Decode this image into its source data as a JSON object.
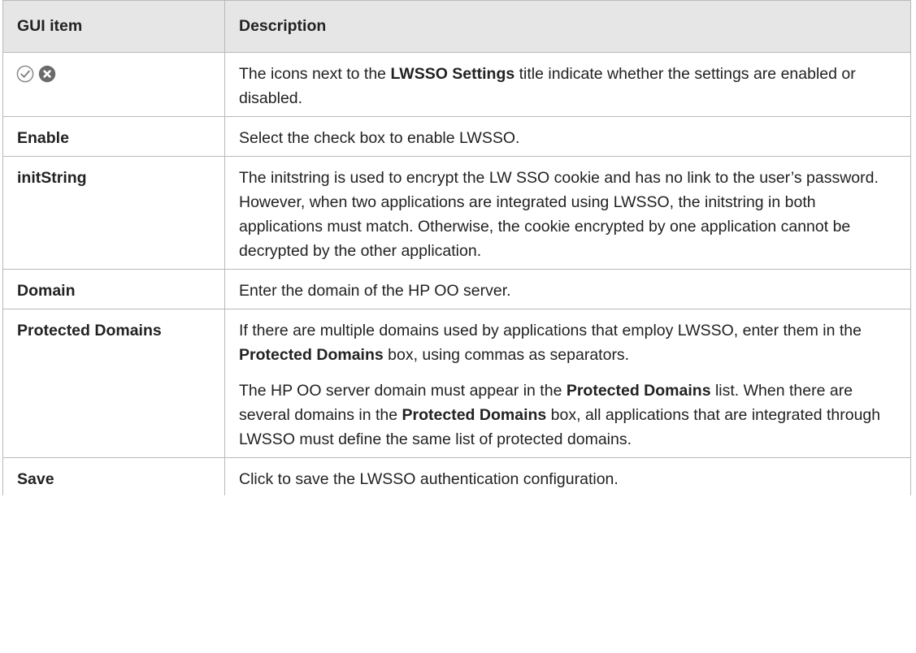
{
  "table": {
    "headers": {
      "item": "GUI item",
      "description": "Description"
    },
    "rows": {
      "icons": {
        "icon_names": [
          "check-circle-icon",
          "x-circle-icon"
        ],
        "desc": {
          "t1": "The icons next to the ",
          "b1": "LWSSO Settings",
          "t2": " title indicate whether the settings are enabled or disabled."
        }
      },
      "enable": {
        "label": "Enable",
        "desc": "Select the check box to enable LWSSO."
      },
      "initstring": {
        "label": "initString",
        "desc": "The initstring is used to encrypt the LW SSO cookie and has no link to the user’s password. However, when two applications are integrated using LWSSO, the initstring in both applications must match. Otherwise, the cookie encrypted by one application cannot be decrypted by the other application."
      },
      "domain": {
        "label": "Domain",
        "desc": "Enter the domain of the HP OO server."
      },
      "protected": {
        "label": "Protected Domains",
        "p1": {
          "t1": "If there are multiple domains used by applications that employ LWSSO, enter them in the ",
          "b1": "Protected Domains",
          "t2": " box, using commas as separators."
        },
        "p2": {
          "t1": "The HP OO server domain must appear in the ",
          "b1": "Protected Domains",
          "t2": " list. When there are several domains in the ",
          "b2": "Protected Domains",
          "t3": " box, all applications that are integrated through LWSSO must define the same list of protected domains."
        }
      },
      "save": {
        "label": "Save",
        "desc": "Click to save the LWSSO authentication configuration."
      }
    }
  },
  "colors": {
    "header_bg": "#e6e6e6",
    "border": "#b9b9b9",
    "text": "#222222",
    "icon_fill": "#6b6b6b"
  }
}
